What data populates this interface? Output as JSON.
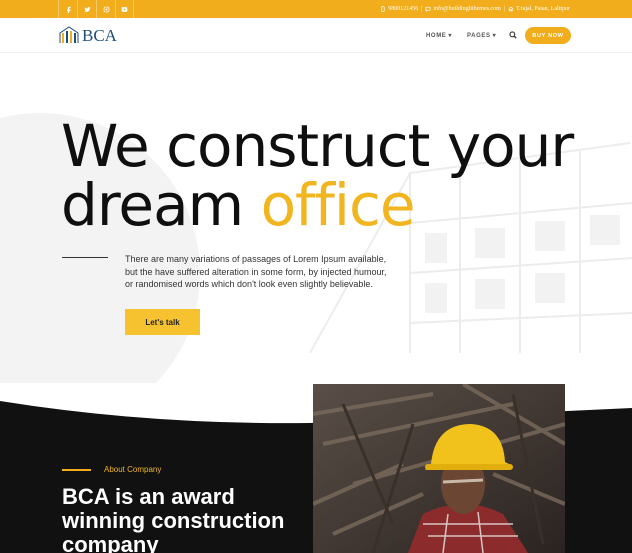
{
  "topbar": {
    "social": [
      {
        "name": "facebook-icon"
      },
      {
        "name": "twitter-icon"
      },
      {
        "name": "instagram-icon"
      },
      {
        "name": "youtube-icon"
      }
    ],
    "phone": "9800121456",
    "email": "info@buildinglithemes.com",
    "address": "T.rajal, Patan, Lalitpur",
    "separator": "|",
    "accent_color": "#f1ad1b"
  },
  "nav": {
    "logo_text": "BCA",
    "home_label": "HOME",
    "pages_label": "PAGES",
    "chevron": "▾",
    "buy_label": "BUY NOW"
  },
  "hero": {
    "line1": "We construct your",
    "line2_plain": "dream",
    "line2_accent": "office",
    "description": "There are many variations of passages of Lorem Ipsum available, but the have suffered alteration in some form, by injected humour, or randomised words which don't look even slightly believable.",
    "cta_label": "Let's talk"
  },
  "about": {
    "label": "About Company",
    "title": "BCA is an award winning construction company"
  },
  "colors": {
    "brand_yellow": "#f1ad1b",
    "accent_text": "#f1b51f",
    "dark_bg": "#111111",
    "logo_blue": "#1c4f7a"
  }
}
